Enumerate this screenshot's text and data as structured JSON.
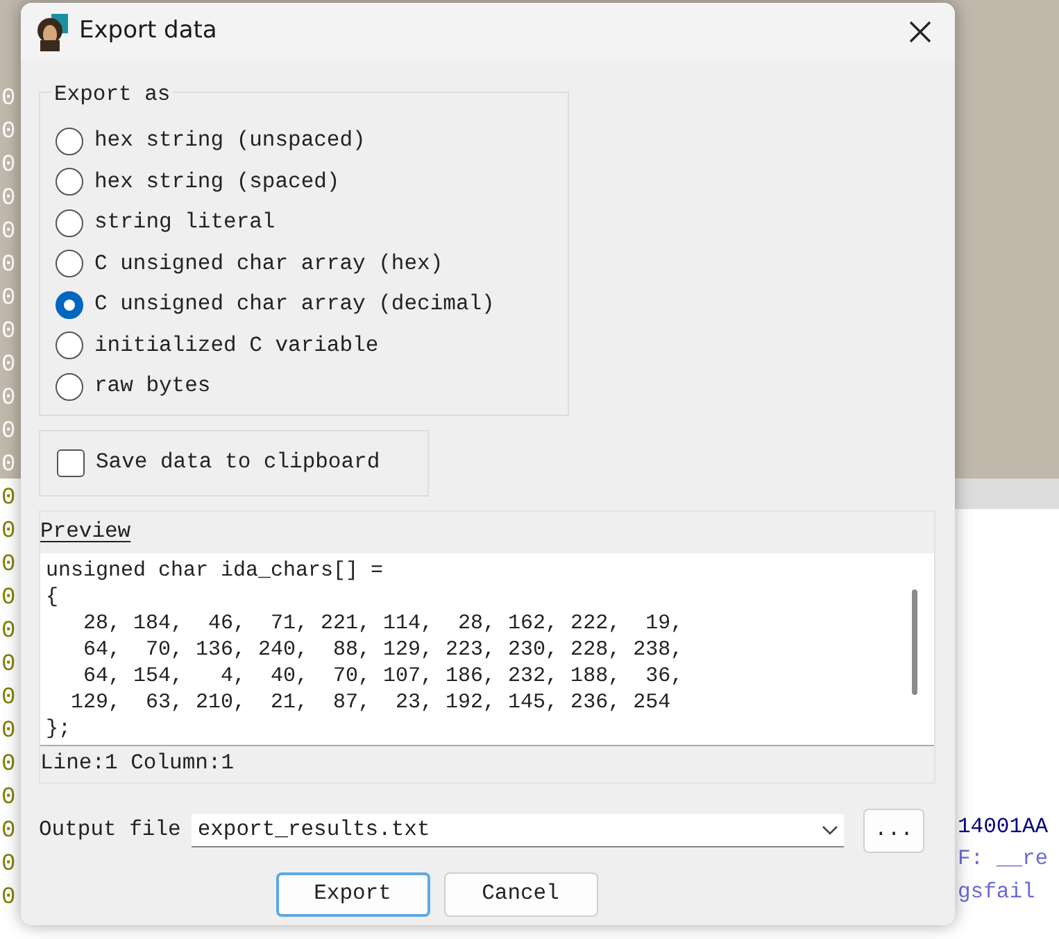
{
  "background": {
    "gutter": [
      "0",
      "0",
      "0",
      "0",
      "0",
      "0",
      "0",
      "0",
      "0",
      "0",
      "0",
      "0",
      "0",
      "0",
      "0",
      "0",
      "0",
      "0",
      "0",
      "0",
      "0",
      "0",
      "0",
      "0",
      "0"
    ],
    "right_fragments": [
      "14001AA",
      "F: __re",
      "gsfail"
    ]
  },
  "window": {
    "title": "Export data"
  },
  "export_as": {
    "title": "Export as",
    "options": [
      {
        "label": "hex string (unspaced)",
        "selected": false
      },
      {
        "label": "hex string (spaced)",
        "selected": false
      },
      {
        "label": "string literal",
        "selected": false
      },
      {
        "label": "C unsigned char array (hex)",
        "selected": false
      },
      {
        "label": "C unsigned char array (decimal)",
        "selected": true
      },
      {
        "label": "initialized C variable",
        "selected": false
      },
      {
        "label": "raw bytes",
        "selected": false
      }
    ]
  },
  "clipboard": {
    "label": "Save data to clipboard",
    "checked": false
  },
  "preview": {
    "title": "Preview",
    "lines": [
      "unsigned char ida_chars[] =",
      "{",
      "   28, 184,  46,  71, 221, 114,  28, 162, 222,  19,",
      "   64,  70, 136, 240,  88, 129, 223, 230, 228, 238,",
      "   64, 154,   4,  40,  70, 107, 186, 232, 188,  36,",
      "  129,  63, 210,  21,  87,  23, 192, 145, 236, 254",
      "};"
    ],
    "status": "Line:1  Column:1"
  },
  "output_file": {
    "label": "Output file",
    "value": "export_results.txt",
    "browse": "..."
  },
  "buttons": [
    {
      "label": "Export",
      "default": true
    },
    {
      "label": "Cancel",
      "default": false
    }
  ]
}
